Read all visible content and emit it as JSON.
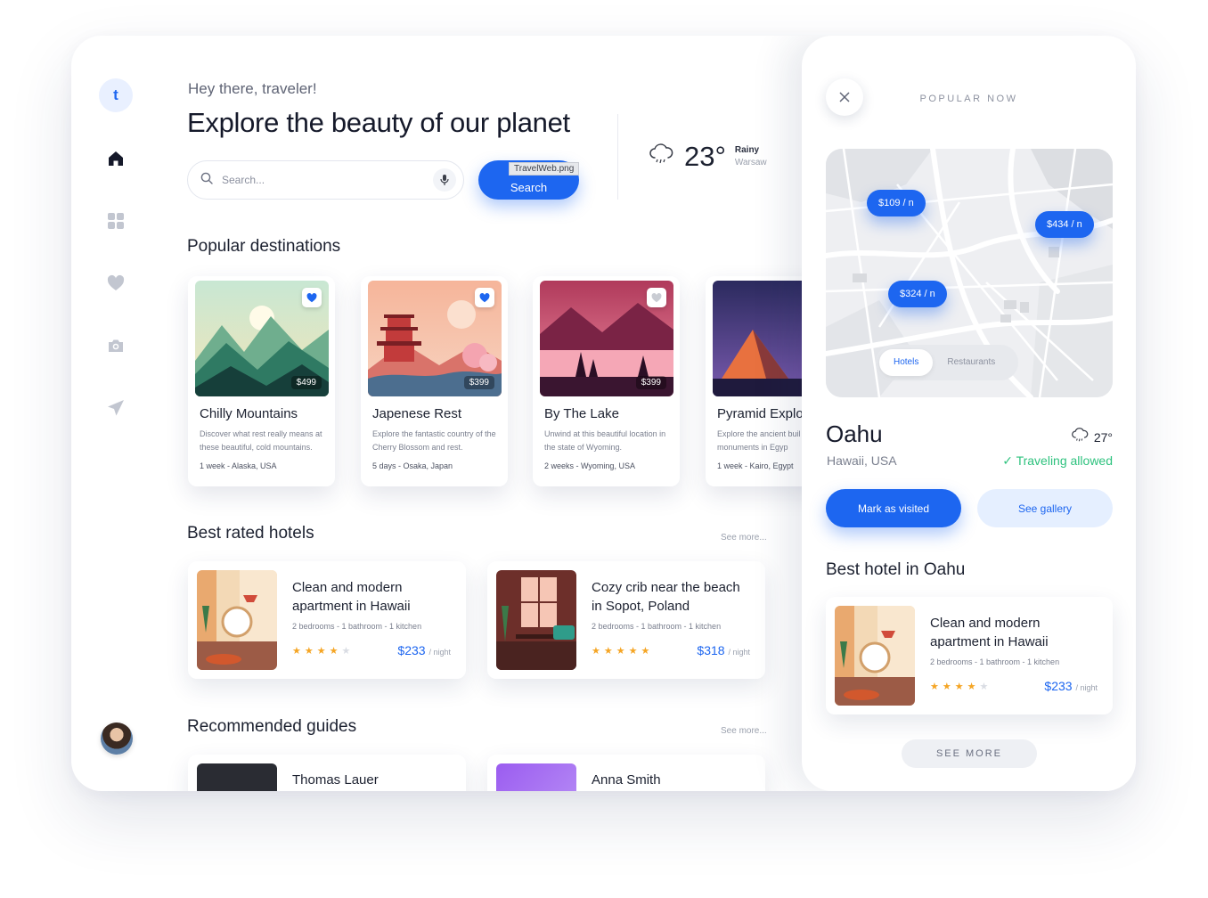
{
  "sidebar": {
    "logo": "t",
    "items": [
      {
        "name": "home-icon",
        "active": true
      },
      {
        "name": "dashboard-icon",
        "active": false
      },
      {
        "name": "heart-icon",
        "active": false
      },
      {
        "name": "camera-icon",
        "active": false
      },
      {
        "name": "send-icon",
        "active": false
      }
    ]
  },
  "header": {
    "greeting": "Hey there, traveler!",
    "title": "Explore the beauty of our planet"
  },
  "search": {
    "placeholder": "Search...",
    "button_label": "Search",
    "tooltip": "TravelWeb.png"
  },
  "weather": {
    "temp": "23°",
    "condition": "Rainy",
    "city": "Warsaw"
  },
  "destinations": {
    "title": "Popular destinations",
    "items": [
      {
        "name": "Chilly Mountains",
        "description": "Discover what rest really means at these beautiful, cold mountains.",
        "meta": "1 week - Alaska, USA",
        "price": "$499",
        "favorited": true
      },
      {
        "name": "Japenese Rest",
        "description": "Explore the fantastic country of the Cherry Blossom and rest.",
        "meta": "5 days - Osaka, Japan",
        "price": "$399",
        "favorited": true
      },
      {
        "name": "By The Lake",
        "description": "Unwind at this beautiful location in the state of Wyoming.",
        "meta": "2 weeks - Wyoming, USA",
        "price": "$399",
        "favorited": false
      },
      {
        "name": "Pyramid Explo",
        "description": "Explore the ancient buil and monuments in Egyp",
        "meta": "1 week - Kairo, Egypt",
        "price": "",
        "favorited": false
      }
    ]
  },
  "hotels": {
    "title": "Best rated hotels",
    "see_more": "See more...",
    "items": [
      {
        "name": "Clean and modern apartment in Hawaii",
        "meta": "2 bedrooms - 1 bathroom - 1 kitchen",
        "rating": 4,
        "price": "$233",
        "unit": "/ night"
      },
      {
        "name": "Cozy crib near the beach in Sopot, Poland",
        "meta": "2 bedrooms - 1 bathroom - 1 kitchen",
        "rating": 5,
        "price": "$318",
        "unit": "/ night"
      }
    ]
  },
  "guides": {
    "title": "Recommended guides",
    "see_more": "See more...",
    "items": [
      {
        "name": "Thomas Lauer"
      },
      {
        "name": "Anna Smith"
      }
    ]
  },
  "panel": {
    "title": "POPULAR NOW",
    "map": {
      "pins": [
        "$109 / n",
        "$434 / n",
        "$324 / n"
      ],
      "tabs": [
        "Hotels",
        "Restaurants"
      ],
      "active_tab": "Hotels"
    },
    "place": {
      "name": "Oahu",
      "region": "Hawaii, USA",
      "temp": "27°",
      "status": "✓ Traveling allowed"
    },
    "primary_button": "Mark as visited",
    "secondary_button": "See gallery",
    "best_title": "Best hotel in Oahu",
    "hotel": {
      "name": "Clean and modern apartment in Hawaii",
      "meta": "2 bedrooms - 1 bathroom - 1 kitchen",
      "rating": 4,
      "price": "$233",
      "unit": "/ night"
    },
    "see_more": "SEE MORE"
  },
  "colors": {
    "accent": "#1d66f0",
    "accent_light": "#e5efff",
    "star": "#f5a524",
    "success": "#2ec27e"
  }
}
